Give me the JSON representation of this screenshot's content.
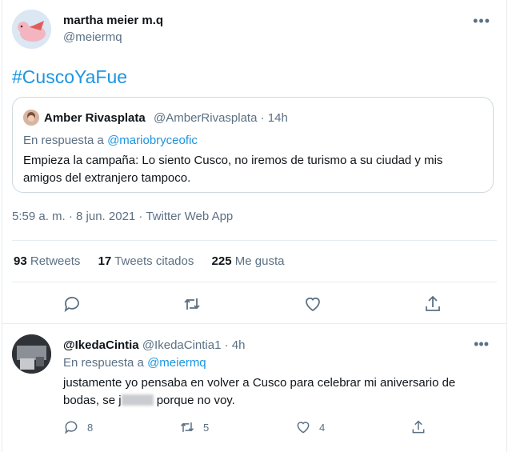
{
  "colors": {
    "accent": "#1b95e0",
    "muted": "#5b7083",
    "text": "#0f1419"
  },
  "tweet": {
    "author_name": "martha meier m.q",
    "author_handle": "@meiermq",
    "more_label": "•••",
    "hashtag": "#CuscoYaFue",
    "quoted": {
      "author_name": "Amber Rivasplata",
      "meta": "@AmberRivasplata · 14h",
      "reply_prefix": "En respuesta a",
      "reply_to": "@mariobryceofic",
      "text": "Empieza la campaña: Lo siento Cusco, no iremos de turismo a su ciudad y mis amigos del extranjero tampoco."
    },
    "timestamp": "5:59 a. m. · 8 jun. 2021 · Twitter Web App",
    "stats": {
      "retweets_count": "93",
      "retweets_label": "Retweets",
      "quotes_count": "17",
      "quotes_label": "Tweets citados",
      "likes_count": "225",
      "likes_label": "Me gusta"
    },
    "actions": [
      "reply-icon",
      "retweet-icon",
      "like-icon",
      "share-icon"
    ]
  },
  "reply": {
    "author_name": "@IkedaCintia",
    "meta": "@IkedaCintia1 · 4h",
    "more_label": "•••",
    "reply_prefix": "En respuesta a",
    "reply_to": "@meiermq",
    "text_part1": "justamente yo pensaba en volver a Cusco para celebrar mi aniversario de bodas,  se j",
    "text_part2": " porque no voy.",
    "reply_count": "8",
    "retweet_count": "5",
    "like_count": "4"
  }
}
